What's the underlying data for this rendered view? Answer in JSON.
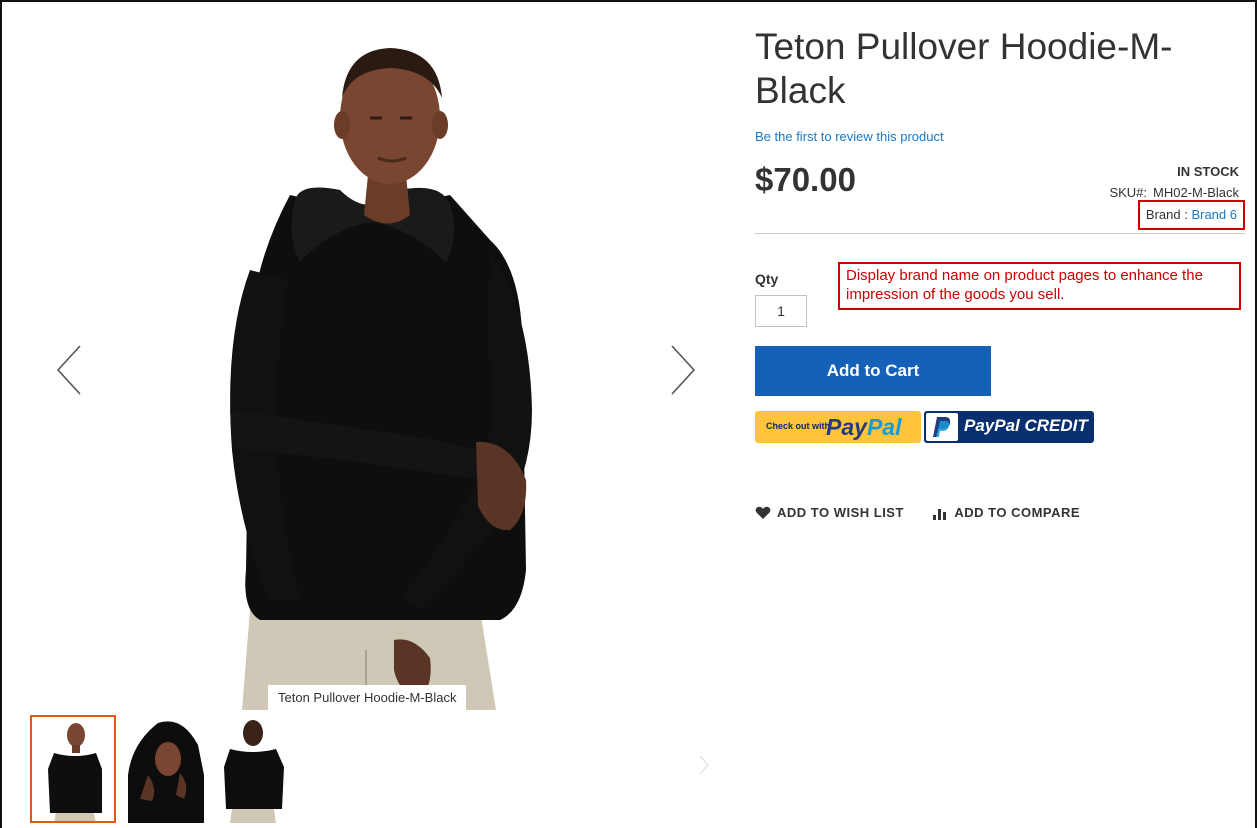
{
  "product": {
    "title": "Teton Pullover Hoodie-M-Black",
    "review_link": "Be the first to review this product",
    "price": "$70.00",
    "stock": "IN STOCK",
    "sku_label": "SKU#:",
    "sku_value": "MH02-M-Black",
    "brand_label": "Brand :",
    "brand_value": "Brand 6"
  },
  "gallery": {
    "caption": "Teton Pullover Hoodie-M-Black",
    "prev_icon": "chevron-left-icon",
    "next_icon": "chevron-right-icon",
    "thumbnails": [
      "front",
      "hood-up",
      "back"
    ]
  },
  "cart": {
    "qty_label": "Qty",
    "qty_value": "1",
    "add_to_cart_label": "Add to Cart"
  },
  "paypal": {
    "checkout_small": "Check out with",
    "logo_pay": "Pay",
    "logo_pal": "Pal",
    "credit_label": "PayPal CREDIT",
    "checkout_color": "#ffc439",
    "credit_color": "#0a2f6e"
  },
  "callout": {
    "text": "Display brand name on product pages to enhance the impression of the goods you sell.",
    "color": "#cc0000"
  },
  "actions": {
    "wishlist_label": "ADD TO WISH LIST",
    "compare_label": "ADD TO COMPARE"
  },
  "colors": {
    "accent_button": "#1561b8",
    "link": "#1979c3",
    "active_thumb": "#e05b12"
  }
}
